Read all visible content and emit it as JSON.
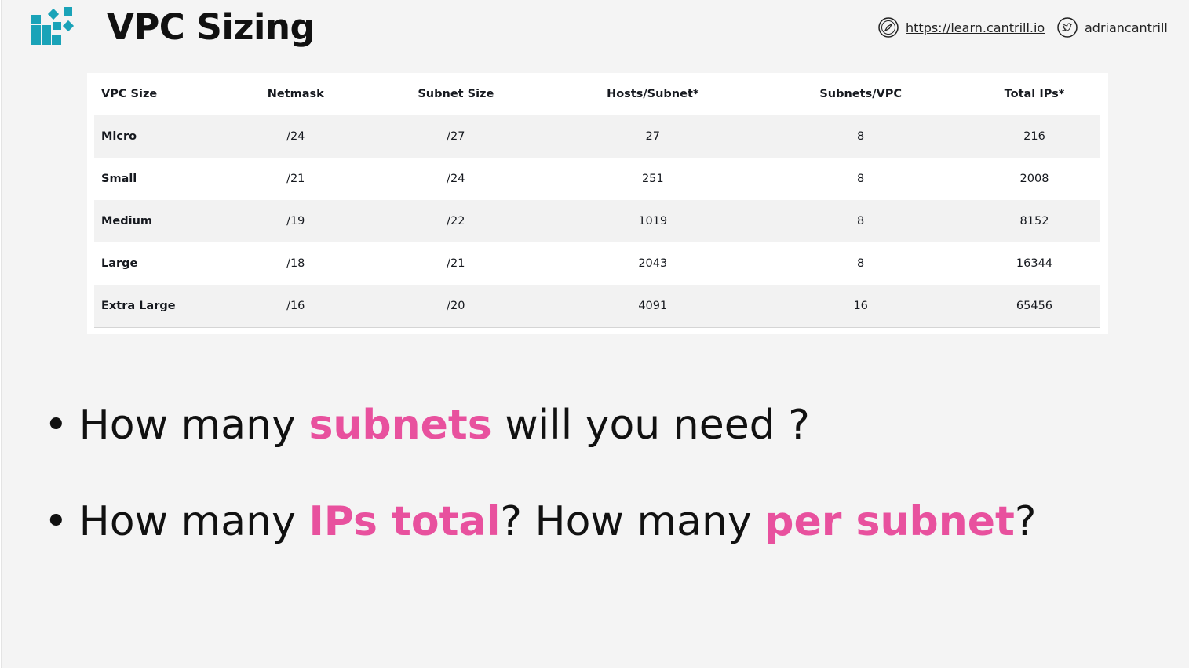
{
  "header": {
    "title": "VPC Sizing",
    "website_label": "https://learn.cantrill.io",
    "twitter_label": "adriancantrill",
    "icons": {
      "logo": "stacked-cubes-logo",
      "website": "compass-icon",
      "twitter": "bird-icon"
    }
  },
  "table": {
    "headers": [
      "VPC Size",
      "Netmask",
      "Subnet Size",
      "Hosts/Subnet*",
      "Subnets/VPC",
      "Total IPs*"
    ],
    "rows": [
      [
        "Micro",
        "/24",
        "/27",
        "27",
        "8",
        "216"
      ],
      [
        "Small",
        "/21",
        "/24",
        "251",
        "8",
        "2008"
      ],
      [
        "Medium",
        "/19",
        "/22",
        "1019",
        "8",
        "8152"
      ],
      [
        "Large",
        "/18",
        "/21",
        "2043",
        "8",
        "16344"
      ],
      [
        "Extra Large",
        "/16",
        "/20",
        "4091",
        "16",
        "65456"
      ]
    ]
  },
  "bullets": {
    "b1": {
      "p1": "How many ",
      "h1": "subnets",
      "p2": " will you need ?"
    },
    "b2": {
      "p1": "How many ",
      "h1": "IPs total",
      "p2": "? How many ",
      "h2": "per subnet",
      "p3": "?"
    }
  },
  "colors": {
    "highlight": "#e8519e",
    "logo_teal": "#1aa3b8",
    "background": "#f4f4f4"
  }
}
